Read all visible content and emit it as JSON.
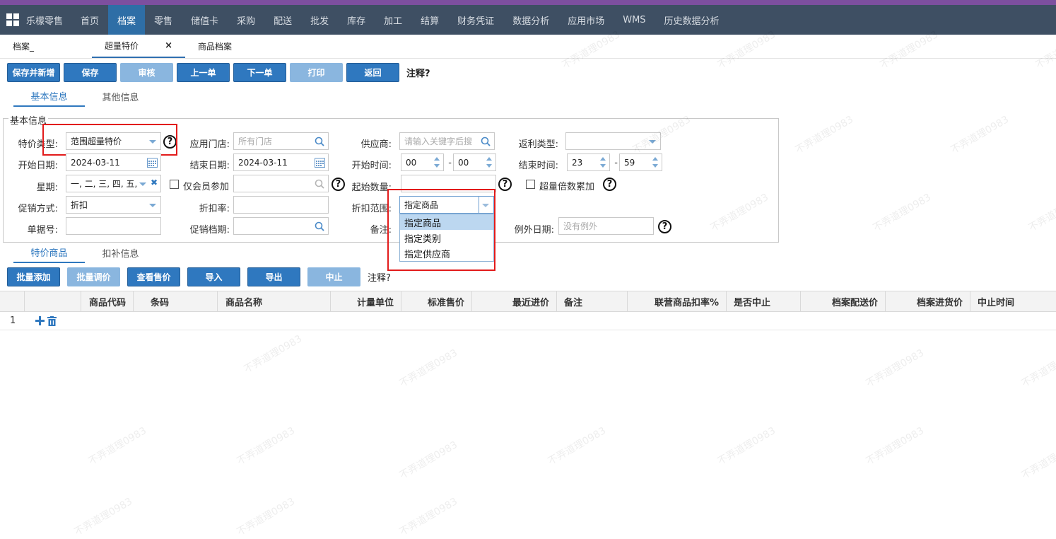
{
  "navbar": {
    "brand": "乐檬零售",
    "items": [
      "首页",
      "档案",
      "零售",
      "储值卡",
      "采购",
      "配送",
      "批发",
      "库存",
      "加工",
      "结算",
      "财务凭证",
      "数据分析",
      "应用市场",
      "WMS",
      "历史数据分析"
    ],
    "active_index": 1
  },
  "page_tabs": {
    "archive": "档案_",
    "special": "超量特价",
    "close": "×",
    "product": "商品档案"
  },
  "toolbar": {
    "save_new": "保存并新增",
    "save": "保存",
    "audit": "审核",
    "prev": "上一单",
    "next": "下一单",
    "print": "打印",
    "back": "返回",
    "note": "注释?"
  },
  "info_tabs": {
    "basic": "基本信息",
    "other": "其他信息"
  },
  "form": {
    "legend": "基本信息",
    "price_type_label": "特价类型:",
    "price_type_value": "范围超量特价",
    "store_label": "应用门店:",
    "store_placeholder": "所有门店",
    "supplier_label": "供应商:",
    "supplier_placeholder": "请输入关键字后搜",
    "rebate_label": "返利类型:",
    "start_date_label": "开始日期:",
    "start_date": "2024-03-11",
    "end_date_label": "结束日期:",
    "end_date": "2024-03-11",
    "start_time_label": "开始时间:",
    "start_hour": "00",
    "start_min": "00",
    "end_time_label": "结束时间:",
    "end_hour": "23",
    "end_min": "59",
    "dash": "-",
    "week_label": "星期:",
    "week_value": "一, 二, 三, 四, 五,",
    "member_only": "仅会员参加",
    "start_qty_label": "起始数量:",
    "multiple_label": "超量倍数累加",
    "promo_label": "促销方式:",
    "promo_value": "折扣",
    "discount_label": "折扣率:",
    "scope_label": "折扣范围:",
    "scope_value": "指定商品",
    "doc_no_label": "单据号:",
    "schedule_label": "促销档期:",
    "remark_label": "备注:",
    "exception_label": "例外日期:",
    "exception_placeholder": "没有例外",
    "help": "?"
  },
  "scope_options": [
    "指定商品",
    "指定类别",
    "指定供应商"
  ],
  "detail_tabs": {
    "products": "特价商品",
    "subsidy": "扣补信息"
  },
  "grid_toolbar": {
    "batch_add": "批量添加",
    "batch_price": "批量调价",
    "view_price": "查看售价",
    "import": "导入",
    "export": "导出",
    "stop": "中止",
    "note": "注释?"
  },
  "grid": {
    "columns": [
      "商品代码",
      "条码",
      "商品名称",
      "计量单位",
      "标准售价",
      "最近进价",
      "备注",
      "联营商品扣率%",
      "是否中止",
      "档案配送价",
      "档案进货价",
      "中止时间"
    ],
    "rows": [
      {
        "no": "1"
      }
    ]
  },
  "watermark": "不弄道理0983",
  "colors": {
    "nav_bg": "#3e4f63",
    "accent": "#2f78bf",
    "highlight": "#e21b1b"
  }
}
